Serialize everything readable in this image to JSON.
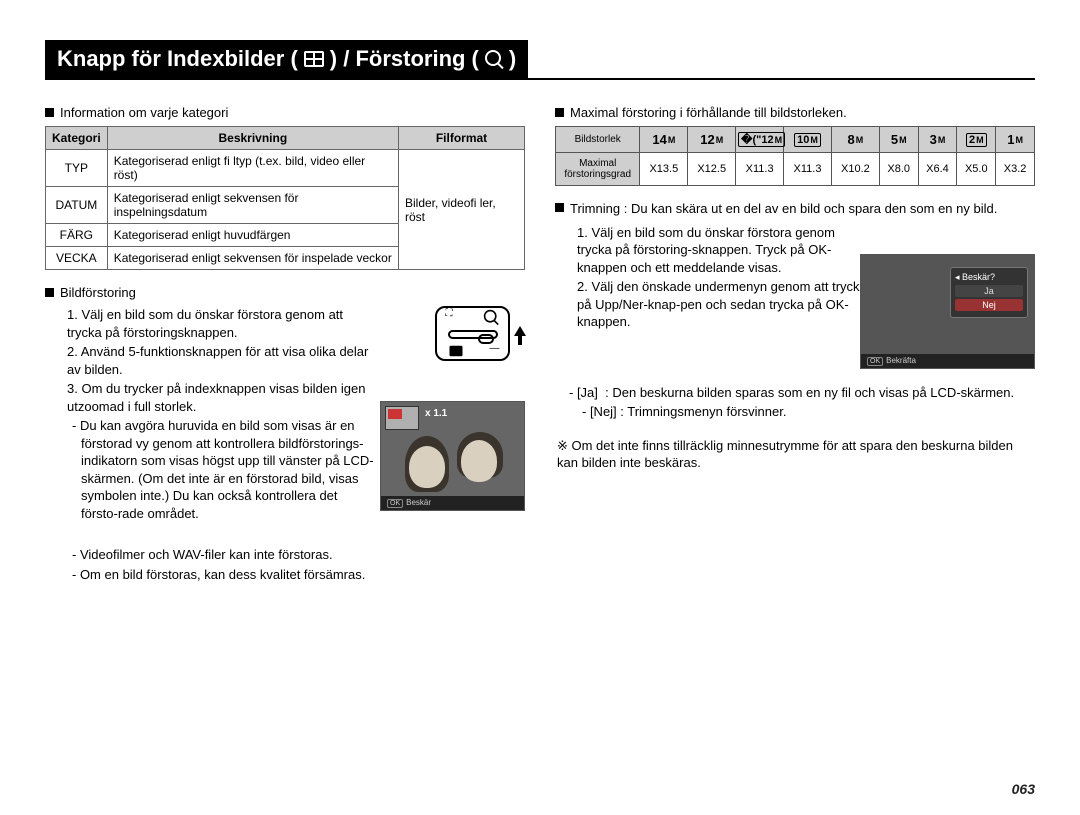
{
  "title": {
    "prefix": "Knapp för Indexbilder (",
    "mid": ") / Förstoring (",
    "suffix": ")"
  },
  "left": {
    "heading": "Information om varje kategori",
    "table": {
      "h1": "Kategori",
      "h2": "Beskrivning",
      "h3": "Filformat",
      "r1c1": "TYP",
      "r1c2": "Kategoriserad enligt fi ltyp (t.ex. bild, video eller röst)",
      "r2c1": "DATUM",
      "r2c2": "Kategoriserad enligt sekvensen för inspelningsdatum",
      "r3c1": "FÄRG",
      "r3c2": "Kategoriserad enligt huvudfärgen",
      "r4c1": "VECKA",
      "r4c2": "Kategoriserad enligt sekvensen för inspelade veckor",
      "formats": "Bilder, videofi ler, röst"
    },
    "sub": "Bildförstoring",
    "steps": {
      "s1": "1. Välj en bild som du önskar förstora genom att trycka på förstoringsknappen.",
      "s2": "2. Använd 5-funktionsknappen för att visa olika delar av bilden.",
      "s3": "3. Om du trycker på indexknappen visas bilden igen utzoomad i full storlek.",
      "d1": "- Du kan avgöra huruvida en bild som visas är en förstorad vy genom att kontrollera bildförstorings-indikatorn som visas högst upp till vänster på LCD-skärmen. (Om det inte är en förstorad bild, visas symbolen inte.) Du kan också kontrollera det försto-rade området.",
      "d2": "- Videofilmer och WAV-filer kan inte förstoras.",
      "d3": "- Om en bild förstoras, kan dess kvalitet försämras."
    },
    "thumb": {
      "zoom": "x 1.1",
      "bar": "Beskär"
    }
  },
  "right": {
    "heading": "Maximal förstoring i förhållande till bildstorleken.",
    "table": {
      "r1": "Bildstorlek",
      "r2a": "Maximal",
      "r2b": "förstoringsgrad",
      "v": [
        "X13.5",
        "X12.5",
        "X11.3",
        "X11.3",
        "X10.2",
        "X8.0",
        "X6.4",
        "X5.0",
        "X3.2"
      ]
    },
    "trim_label": "Trimning :",
    "trim_text": "Du kan skära ut en del av en bild och spara den som en ny bild.",
    "steps": {
      "s1": "1. Välj en bild som du önskar förstora genom trycka på förstoring-sknappen. Tryck på OK-knappen och ett meddelande visas.",
      "s2": "2. Välj den önskade undermenyn genom att trycka på Upp/Ner-knap-pen och sedan trycka på OK-knappen.",
      "ja1": "- [Ja]",
      "ja2": ": Den beskurna bilden sparas som en ny fil och visas på LCD-skärmen.",
      "nej": "- [Nej] : Trimningsmenyn försvinner."
    },
    "note": "※ Om det inte finns tillräcklig minnesutrymme för att spara den beskurna bilden kan bilden inte beskäras.",
    "crop": {
      "hdr": "Beskär?",
      "opt1": "Ja",
      "opt2": "Nej",
      "bar": "Bekräfta"
    }
  },
  "chart_data": {
    "type": "table",
    "title": "Maximal förstoring i förhållande till bildstorleken",
    "row_label": "Maximal förstoringsgrad",
    "categories": [
      "14M",
      "12M",
      "12M (wide)",
      "10M (wide)",
      "8M",
      "5M",
      "3M",
      "2M (wide)",
      "1M"
    ],
    "values": [
      13.5,
      12.5,
      11.3,
      11.3,
      10.2,
      8.0,
      6.4,
      5.0,
      3.2
    ]
  },
  "page": "063"
}
